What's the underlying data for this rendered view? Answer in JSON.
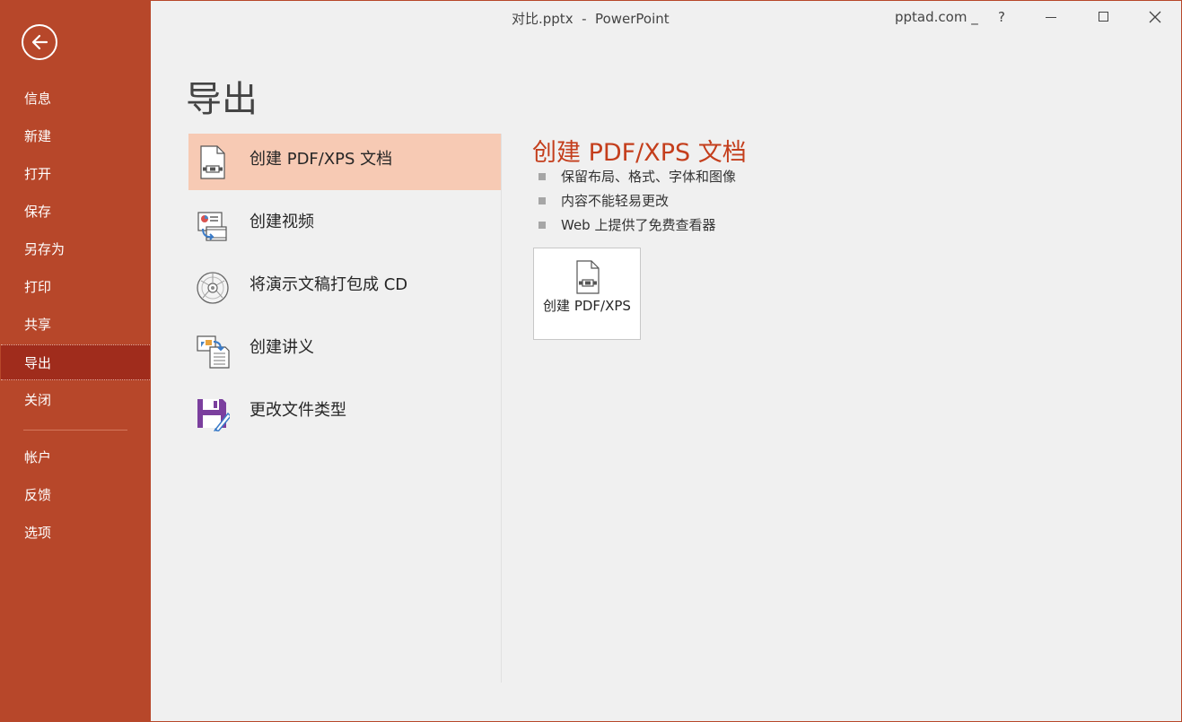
{
  "window": {
    "title": "对比.pptx  -  PowerPoint",
    "account": "pptad.com _",
    "help_label": "?"
  },
  "sidebar": {
    "items": [
      {
        "label": "信息",
        "icon": "info"
      },
      {
        "label": "新建",
        "icon": "new"
      },
      {
        "label": "打开",
        "icon": "open"
      },
      {
        "label": "保存",
        "icon": "save"
      },
      {
        "label": "另存为",
        "icon": "save-as"
      },
      {
        "label": "打印",
        "icon": "print"
      },
      {
        "label": "共享",
        "icon": "share"
      },
      {
        "label": "导出",
        "icon": "export",
        "active": true
      },
      {
        "label": "关闭",
        "icon": "close"
      }
    ],
    "bottom_items": [
      {
        "label": "帐户"
      },
      {
        "label": "反馈"
      },
      {
        "label": "选项"
      }
    ]
  },
  "main": {
    "title": "导出",
    "options": [
      {
        "label": "创建 PDF/XPS 文档",
        "icon": "pdf-document-icon",
        "selected": true
      },
      {
        "label": "创建视频",
        "icon": "video-icon"
      },
      {
        "label": "将演示文稿打包成 CD",
        "icon": "cd-icon"
      },
      {
        "label": "创建讲义",
        "icon": "handout-icon"
      },
      {
        "label": "更改文件类型",
        "icon": "file-type-icon"
      }
    ]
  },
  "detail": {
    "title": "创建 PDF/XPS 文档",
    "bullets": [
      "保留布局、格式、字体和图像",
      "内容不能轻易更改",
      "Web 上提供了免费查看器"
    ],
    "button_label": "创建 PDF/XPS"
  },
  "colors": {
    "accent": "#b7472a",
    "accent_active": "#a02c1c",
    "selected_option": "#f7cab4",
    "detail_title": "#c43e1c",
    "background": "#f0f0f0"
  }
}
